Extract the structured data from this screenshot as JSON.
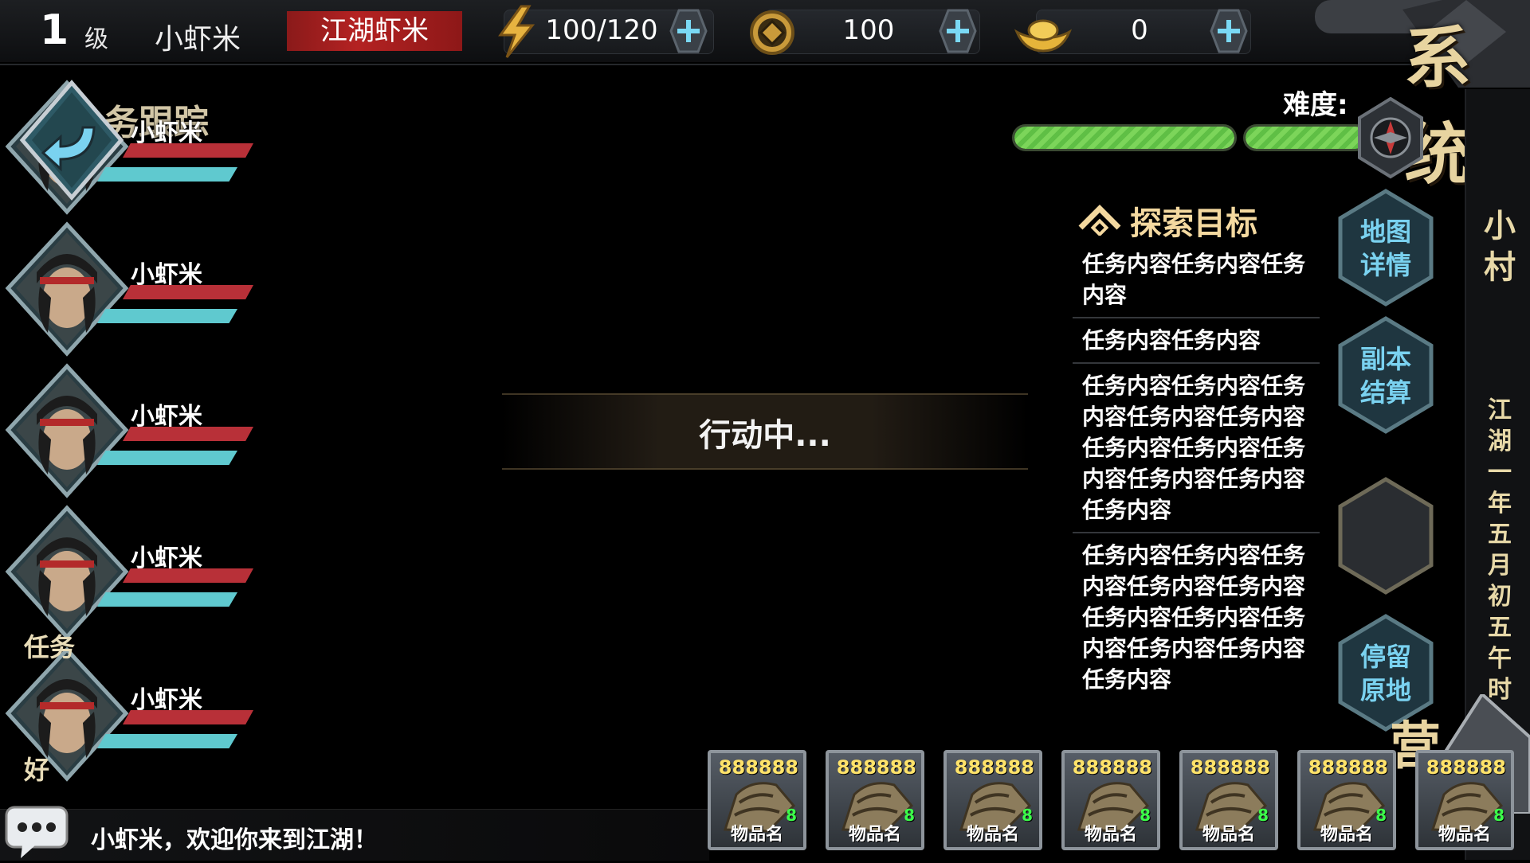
{
  "player": {
    "level": "1",
    "level_unit": "级",
    "name": "小虾米",
    "title": "江湖虾米"
  },
  "resources": {
    "energy": "100/120",
    "coins": "100",
    "ingots": "0"
  },
  "system_label": "系统",
  "difficulty": {
    "label": "难度:",
    "segments": [
      1.0,
      1.0
    ]
  },
  "task_tracking_label": "务跟踪",
  "party": [
    {
      "name": "小虾米",
      "hp": 1.0,
      "mp": 1.0
    },
    {
      "name": "小虾米",
      "hp": 1.0,
      "mp": 1.0
    },
    {
      "name": "小虾米",
      "hp": 1.0,
      "mp": 1.0
    },
    {
      "name": "小虾米",
      "hp": 1.0,
      "mp": 1.0
    },
    {
      "name": "小虾米",
      "hp": 1.0,
      "mp": 1.0
    }
  ],
  "side_tabs": {
    "task": "任务",
    "good": "好"
  },
  "action_status": "行动中...",
  "objectives": {
    "title": "探索目标",
    "items": [
      "任务内容任务内容任务内容",
      "任务内容任务内容",
      "任务内容任务内容任务内容任务内容任务内容任务内容任务内容任务内容任务内容任务内容任务内容",
      "任务内容任务内容任务内容任务内容任务内容任务内容任务内容任务内容任务内容任务内容任务内容"
    ]
  },
  "buttons": {
    "map_details": "地图\n详情",
    "dungeon_settle": "副本\n结算",
    "stay_put": "停留\n原地"
  },
  "bottom_right_deco": "营",
  "location": {
    "village": "小村",
    "date": "江湖一年五月初五午时"
  },
  "chat": {
    "message": "小虾米，欢迎你来到江湖！"
  },
  "inventory": [
    {
      "qty": "888888",
      "count": "8",
      "name": "物品名"
    },
    {
      "qty": "888888",
      "count": "8",
      "name": "物品名"
    },
    {
      "qty": "888888",
      "count": "8",
      "name": "物品名"
    },
    {
      "qty": "888888",
      "count": "8",
      "name": "物品名"
    },
    {
      "qty": "888888",
      "count": "8",
      "name": "物品名"
    },
    {
      "qty": "888888",
      "count": "8",
      "name": "物品名"
    },
    {
      "qty": "888888",
      "count": "8",
      "name": "物品名"
    }
  ],
  "colors": {
    "accent_gold": "#f4d9a0",
    "title_red": "#b42222",
    "hp_red": "#b83038",
    "mp_cyan": "#5fc9cf",
    "difficulty_green": "#7cd55a",
    "hex_label_blue": "#7ad2f0"
  }
}
